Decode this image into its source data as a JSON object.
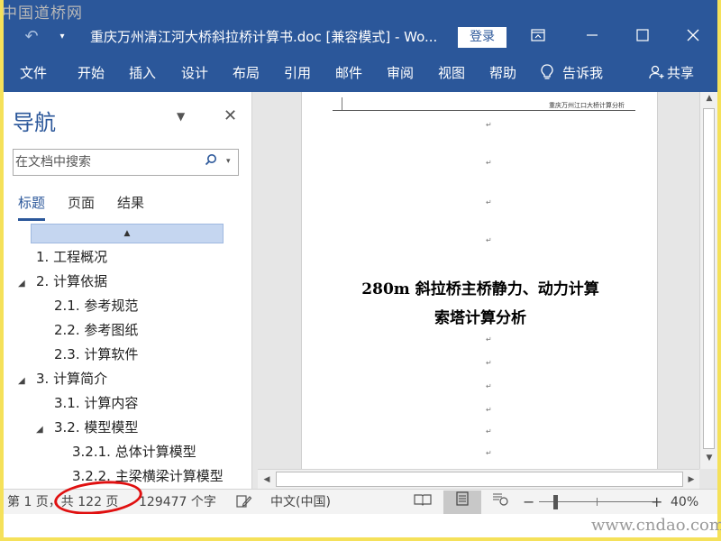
{
  "watermark": {
    "top": "中国道桥网",
    "bottom": "www.cndao.com"
  },
  "titlebar": {
    "title": "重庆万州清江河大桥斜拉桥计算书.doc [兼容模式]  -  Wo...",
    "login_label": "登录",
    "undo_icon": "undo-icon",
    "customize_icon": "chevron-down-icon",
    "ribbon_display_icon": "ribbon-display-icon",
    "minimize_icon": "minimize-icon",
    "maximize_icon": "maximize-icon",
    "close_icon": "close-icon"
  },
  "menu": {
    "tabs": [
      {
        "label": "文件"
      },
      {
        "label": "开始"
      },
      {
        "label": "插入"
      },
      {
        "label": "设计"
      },
      {
        "label": "布局"
      },
      {
        "label": "引用"
      },
      {
        "label": "邮件"
      },
      {
        "label": "审阅"
      },
      {
        "label": "视图"
      },
      {
        "label": "帮助"
      }
    ],
    "tell_me": "告诉我",
    "share": "共享"
  },
  "nav": {
    "title": "导航",
    "search_placeholder": "在文档中搜索",
    "tabs": [
      {
        "label": "标题",
        "active": true
      },
      {
        "label": "页面",
        "active": false
      },
      {
        "label": "结果",
        "active": false
      }
    ],
    "tree": [
      {
        "label": "1. 工程概况",
        "level": 0,
        "expander": ""
      },
      {
        "label": "2. 计算依据",
        "level": 0,
        "expander": "◢"
      },
      {
        "label": "2.1. 参考规范",
        "level": 1,
        "expander": ""
      },
      {
        "label": "2.2. 参考图纸",
        "level": 1,
        "expander": ""
      },
      {
        "label": "2.3. 计算软件",
        "level": 1,
        "expander": ""
      },
      {
        "label": "3. 计算简介",
        "level": 0,
        "expander": "◢"
      },
      {
        "label": "3.1. 计算内容",
        "level": 1,
        "expander": ""
      },
      {
        "label": "3.2. 模型模型",
        "level": 1,
        "expander": "◢"
      },
      {
        "label": "3.2.1. 总体计算模型",
        "level": 2,
        "expander": ""
      },
      {
        "label": "3.2.2. 主梁横梁计算模型",
        "level": 2,
        "expander": ""
      }
    ]
  },
  "document": {
    "header_text": "重庆万州江口大桥计算分析",
    "title_line1": "280m 斜拉桥主桥静力、动力计算",
    "title_line2": "索塔计算分析",
    "para_mark": "↵"
  },
  "status": {
    "page": "第 1 页，共 122 页",
    "words": "129477 个字",
    "language": "中文(中国)",
    "zoom": "40%",
    "zoom_out": "−",
    "zoom_in": "+"
  }
}
